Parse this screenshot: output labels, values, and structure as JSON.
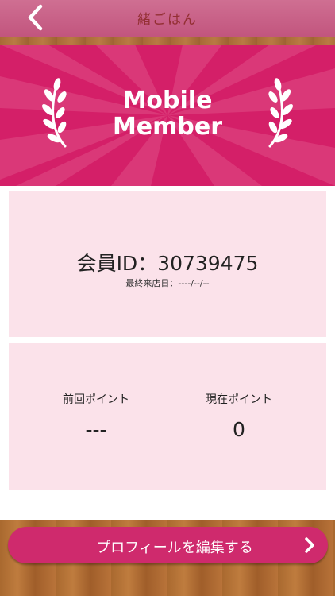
{
  "header": {
    "logo_text": "緒ごはん",
    "back_icon": "chevron-left-icon"
  },
  "banner": {
    "title_line1": "Mobile",
    "title_line2": "Member",
    "laurel_icon": "laurel-branch-icon",
    "color": "#d41f68"
  },
  "member": {
    "id_label": "会員ID：30739475",
    "last_visit": "最終来店日：----/--/--"
  },
  "points": {
    "previous_label": "前回ポイント",
    "previous_value": "---",
    "current_label": "現在ポイント",
    "current_value": "0"
  },
  "footer": {
    "edit_profile_label": "プロフィールを編集する",
    "button_color": "#cf2a6d",
    "chevron_icon": "chevron-right-icon"
  }
}
